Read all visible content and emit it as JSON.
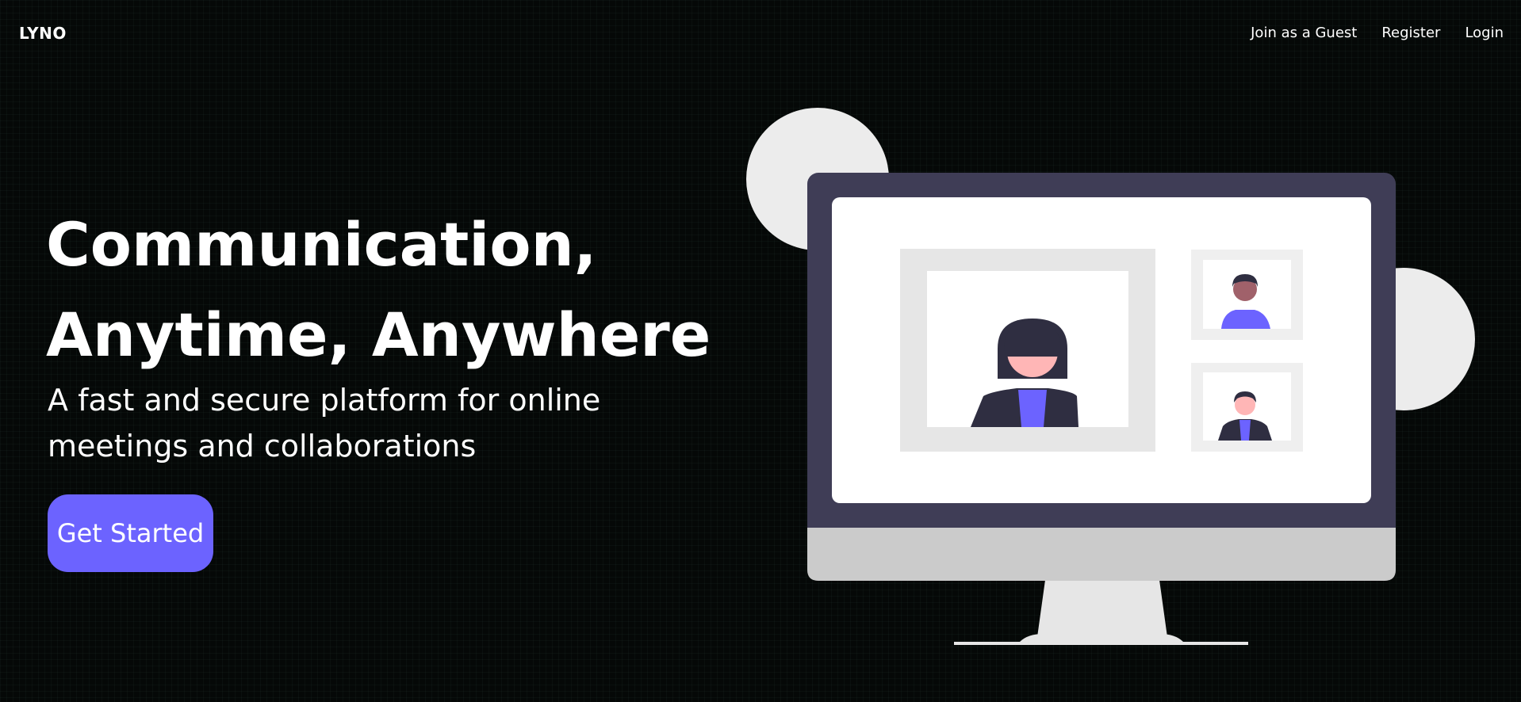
{
  "header": {
    "logo": "LYNO",
    "nav": [
      {
        "label": "Join as a Guest"
      },
      {
        "label": "Register"
      },
      {
        "label": "Login"
      }
    ]
  },
  "hero": {
    "title_line1": "Communication,",
    "title_line2": "Anytime, Anywhere",
    "subtitle": "A fast and secure platform for online meetings and collaborations",
    "cta_label": "Get Started"
  },
  "colors": {
    "background": "#050807",
    "accent": "#6c63ff",
    "monitor_frame": "#3f3d56",
    "monitor_chin": "#cbcbcb",
    "stand": "#e6e6e6",
    "skin": "#ffb6b6",
    "hair": "#2f2e41"
  }
}
